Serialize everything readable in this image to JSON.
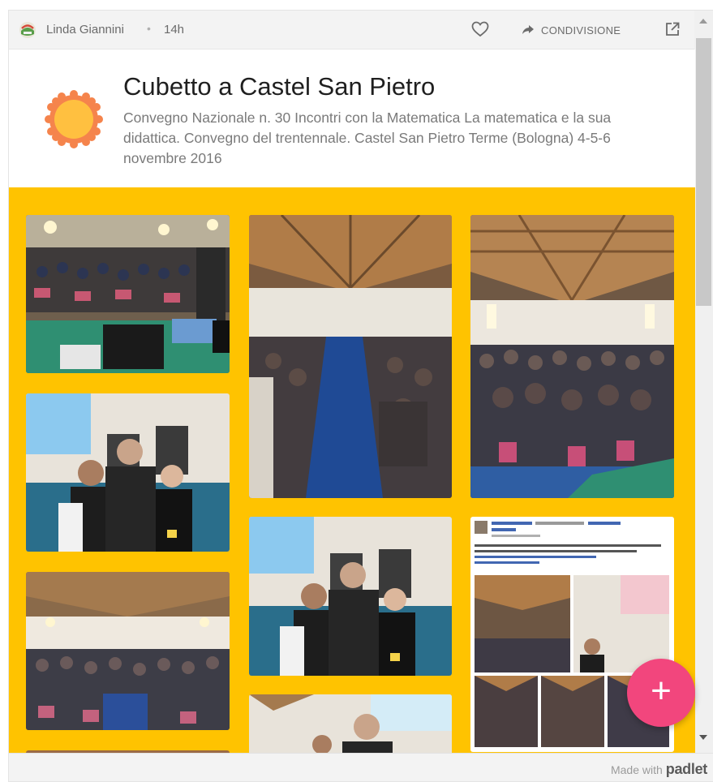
{
  "post": {
    "author": "Linda Giannini",
    "separator": "•",
    "age": "14h",
    "share_label": "CONDIVISIONE"
  },
  "header": {
    "title": "Cubetto a Castel San Pietro",
    "subtitle": "Convegno Nazionale n. 30 Incontri con la Matematica La matematica e la sua didattica. Convegno del trentennale. Castel San Pietro Terme (Bologna) 4-5-6 novembre 2016"
  },
  "footer": {
    "made_with": "Made with",
    "brand": "padlet"
  },
  "fab": {
    "label": "+"
  },
  "colors": {
    "board": "#ffc300",
    "fab": "#f2467d",
    "sun_outer": "#f5844c",
    "sun_inner": "#ffc040"
  },
  "icons": [
    "avatar-icon",
    "heart-icon",
    "share-arrow-icon",
    "open-external-icon",
    "sun-icon",
    "plus-icon"
  ]
}
